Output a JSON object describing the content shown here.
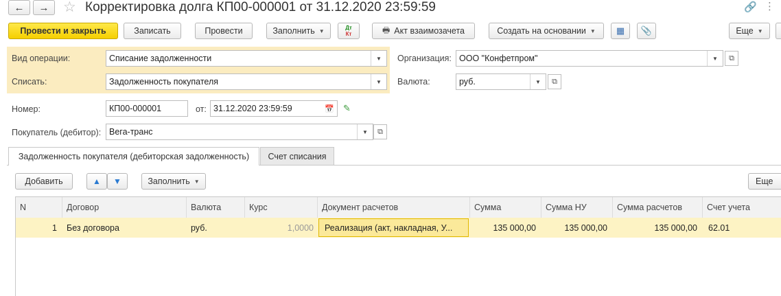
{
  "window": {
    "title": "Корректировка долга КП00-000001 от 31.12.2020 23:59:59",
    "nav_back": "←",
    "nav_forward": "→"
  },
  "toolbar": {
    "post_close": "Провести и закрыть",
    "save": "Записать",
    "post": "Провести",
    "fill": "Заполнить",
    "dt_kt_top": "Дт",
    "dt_kt_bottom": "Кт",
    "offset_act": "Акт взаимозачета",
    "create_based": "Создать на основании",
    "more": "Еще"
  },
  "form": {
    "operation_label": "Вид операции:",
    "operation_value": "Списание задолженности",
    "writeoff_label": "Списать:",
    "writeoff_value": "Задолженность покупателя",
    "org_label": "Организация:",
    "org_value": "ООО \"Конфетпром\"",
    "currency_label": "Валюта:",
    "currency_value": "руб.",
    "number_label": "Номер:",
    "number_value": "КП00-000001",
    "date_label": "от:",
    "date_value": "31.12.2020 23:59:59",
    "buyer_label": "Покупатель (дебитор):",
    "buyer_value": "Вега-транс"
  },
  "tabs": [
    {
      "label": "Задолженность покупателя (дебиторская задолженность)",
      "active": true
    },
    {
      "label": "Счет списания",
      "active": false
    }
  ],
  "table_toolbar": {
    "add": "Добавить",
    "fill": "Заполнить",
    "more": "Еще"
  },
  "table": {
    "headers": [
      "N",
      "Договор",
      "Валюта",
      "Курс",
      "Документ расчетов",
      "Сумма",
      "Сумма НУ",
      "Сумма расчетов",
      "Счет учета"
    ],
    "rows": [
      [
        "1",
        "Без договора",
        "руб.",
        "1,0000",
        "Реализация (акт, накладная, У...",
        "135 000,00",
        "135 000,00",
        "135 000,00",
        "62.01"
      ]
    ]
  },
  "colors": {
    "primary_button": "#f5cf00",
    "highlight_zone": "#fbecc0",
    "selected_row": "#fdf3c4"
  }
}
